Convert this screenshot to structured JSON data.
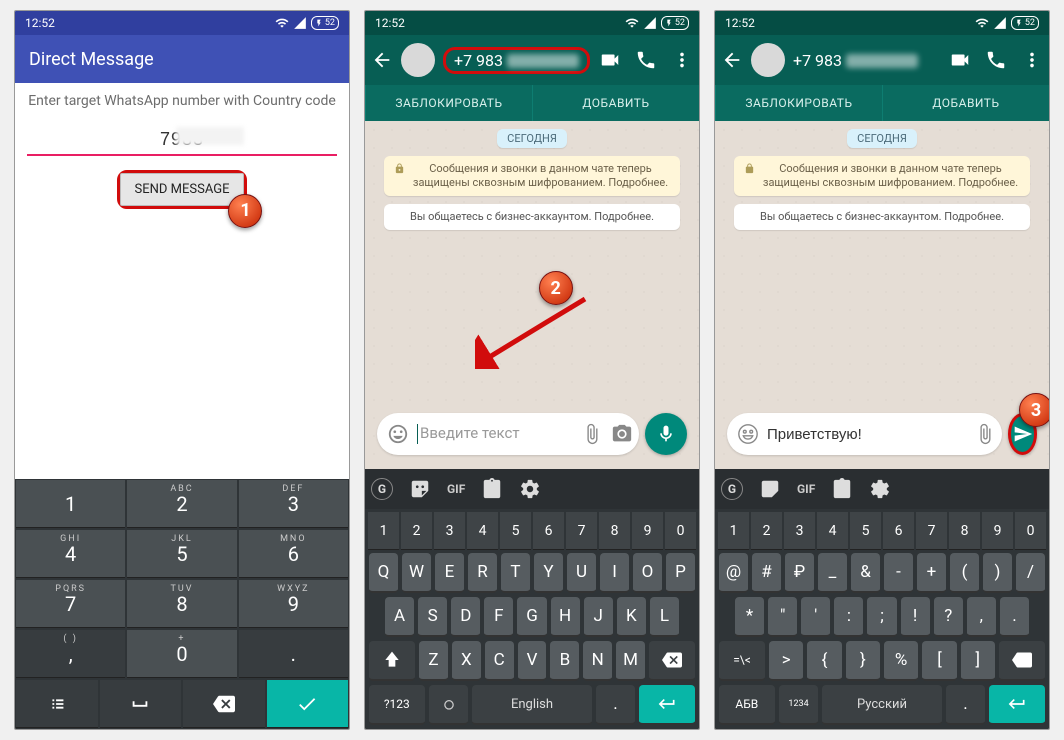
{
  "status": {
    "time": "12:52",
    "battery": "52"
  },
  "phone1": {
    "title": "Direct Message",
    "hint": "Enter target WhatsApp number with Country code",
    "number_prefix": "7983",
    "send_btn": "SEND MESSAGE",
    "callout": "1"
  },
  "keypad": {
    "rows": [
      [
        [
          "1",
          ""
        ],
        [
          "2",
          "ABC"
        ],
        [
          "3",
          "DEF"
        ]
      ],
      [
        [
          "4",
          "GHI"
        ],
        [
          "5",
          "JKL"
        ],
        [
          "6",
          "MNO"
        ]
      ],
      [
        [
          "7",
          "PQRS"
        ],
        [
          "8",
          "TUV"
        ],
        [
          "9",
          "WXYZ"
        ]
      ],
      [
        [
          ",",
          "(  )"
        ],
        [
          "0",
          "+"
        ],
        [
          ".",
          "   "
        ]
      ]
    ]
  },
  "wa": {
    "phone_label": "+7 983",
    "actions": {
      "block": "ЗАБЛОКИРОВАТЬ",
      "add": "ДОБАВИТЬ"
    },
    "today": "СЕГОДНЯ",
    "encryption": "Сообщения и звонки в данном чате теперь защищены сквозным шифрованием. Подробнее.",
    "business": "Вы общаетесь с бизнес-аккаунтом. Подробнее.",
    "placeholder": "Введите текст",
    "callout2": "2",
    "callout3": "3",
    "typed": "Приветствую!"
  },
  "kbtop": {
    "gif": "GIF"
  },
  "qwerty": {
    "nums": [
      "1",
      "2",
      "3",
      "4",
      "5",
      "6",
      "7",
      "8",
      "9",
      "0"
    ],
    "r1": [
      "Q",
      "W",
      "E",
      "R",
      "T",
      "Y",
      "U",
      "I",
      "O",
      "P"
    ],
    "r2": [
      "A",
      "S",
      "D",
      "F",
      "G",
      "H",
      "J",
      "K",
      "L"
    ],
    "r3": [
      "Z",
      "X",
      "C",
      "V",
      "B",
      "N",
      "M"
    ],
    "mode": "?123",
    "lang": "English",
    "comma": ",",
    "dot": "."
  },
  "rus": {
    "r1": [
      "@",
      "#",
      "₽",
      "_",
      "&",
      "-",
      "+",
      "(",
      ")",
      "/"
    ],
    "r2": [
      "*",
      "\"",
      "'",
      ":",
      ";",
      "!",
      "?",
      ",",
      "."
    ],
    "r3": [
      "=\\<",
      ">",
      "{",
      "}",
      "%",
      "[",
      "]"
    ],
    "mode": "АБВ",
    "alt": "1234",
    "lang": "Русский"
  }
}
